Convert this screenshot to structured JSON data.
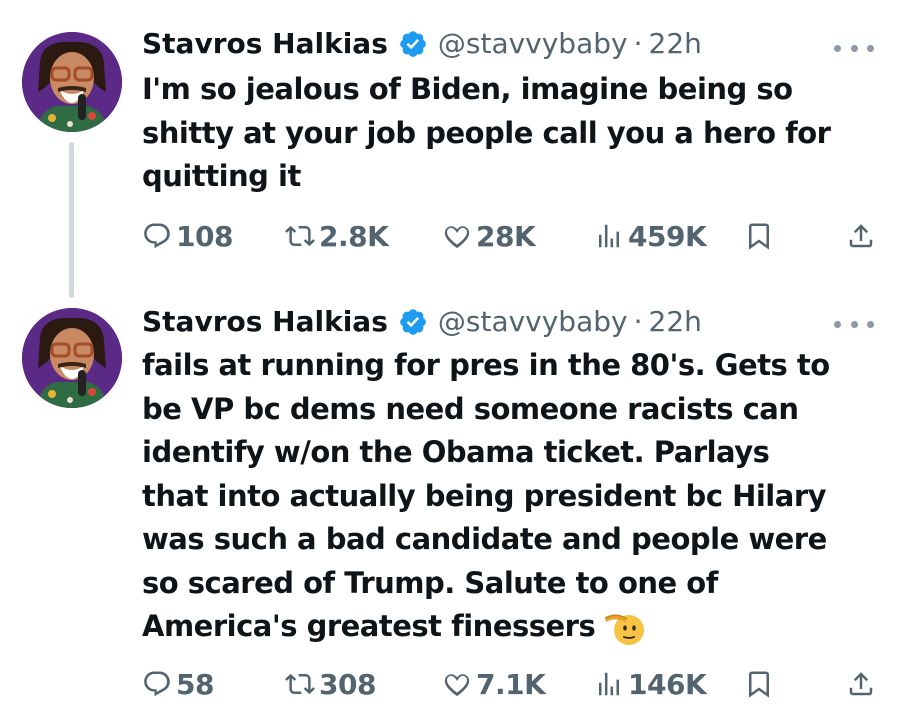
{
  "tweets": [
    {
      "author_name": "Stavros Halkias",
      "handle": "@stavvybaby",
      "separator": "·",
      "time": "22h",
      "text": "I'm so jealous of Biden, imagine being so\nshitty at your job people call you a hero for\nquitting it",
      "stats": {
        "replies": "108",
        "retweets": "2.8K",
        "likes": "28K",
        "views": "459K"
      }
    },
    {
      "author_name": "Stavros Halkias",
      "handle": "@stavvybaby",
      "separator": "·",
      "time": "22h",
      "text": "fails at running for pres in the 80's. Gets to\nbe VP bc dems need someone racists can\nidentify w/on the Obama ticket. Parlays\nthat into actually being president bc Hilary\nwas such a bad candidate and people were\nso scared of Trump. Salute to one of\nAmerica's greatest finessers",
      "stats": {
        "replies": "58",
        "retweets": "308",
        "likes": "7.1K",
        "views": "146K"
      }
    }
  ],
  "icons": {
    "verified": "verified-badge-icon",
    "more": "more-options-icon",
    "reply": "reply-icon",
    "retweet": "retweet-icon",
    "like": "heart-icon",
    "views": "views-icon",
    "bookmark": "bookmark-icon",
    "share": "share-icon",
    "emoji": "saluting-face-icon"
  },
  "colors": {
    "text": "#0f1419",
    "secondary": "#536471",
    "verified_blue": "#1d9bf0",
    "thread_line": "#cfd9de"
  }
}
